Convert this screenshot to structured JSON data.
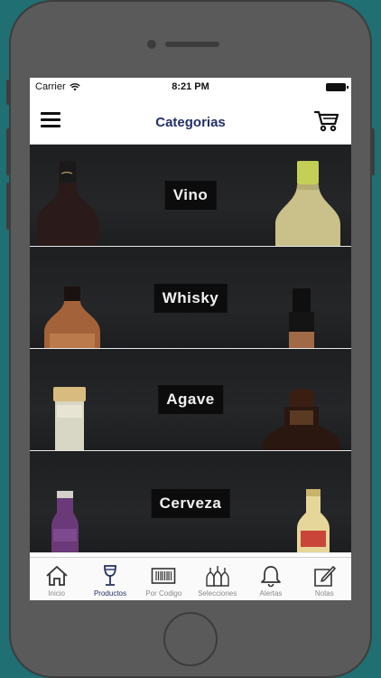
{
  "status_bar": {
    "carrier": "Carrier",
    "time": "8:21 PM"
  },
  "nav": {
    "title": "Categorias"
  },
  "categories": [
    {
      "label": "Vino"
    },
    {
      "label": "Whisky"
    },
    {
      "label": "Agave"
    },
    {
      "label": "Cerveza"
    }
  ],
  "tab_bar": {
    "active": "Productos",
    "items": [
      {
        "label": "Inicio",
        "icon": "home-icon"
      },
      {
        "label": "Productos",
        "icon": "wine-glass-icon"
      },
      {
        "label": "Por Codigo",
        "icon": "barcode-icon"
      },
      {
        "label": "Selecciones",
        "icon": "bottles-icon"
      },
      {
        "label": "Alertas",
        "icon": "bell-icon"
      },
      {
        "label": "Notas",
        "icon": "edit-note-icon"
      }
    ]
  },
  "colors": {
    "accent": "#243066",
    "background": "#1f6f73",
    "category_bg": "#222325"
  }
}
